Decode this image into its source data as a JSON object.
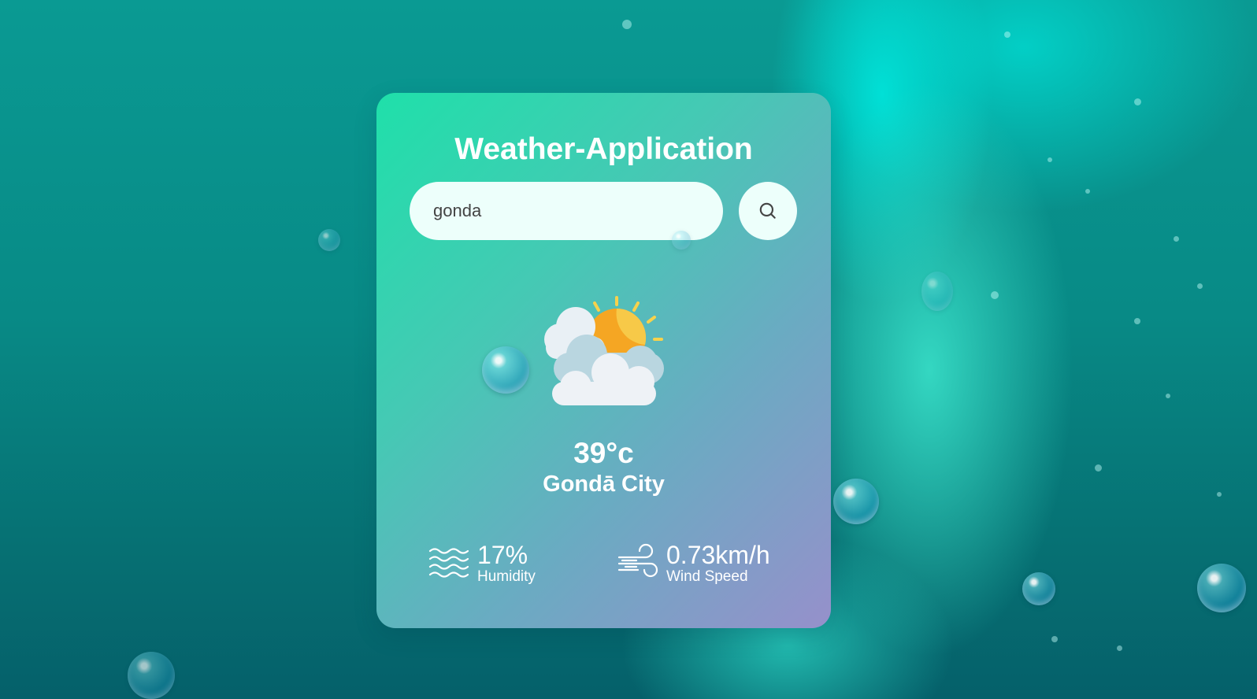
{
  "app": {
    "title": "Weather-Application"
  },
  "search": {
    "value": "gonda",
    "button_icon": "search-icon"
  },
  "weather": {
    "icon": "partly-cloudy-icon",
    "temperature": "39°c",
    "city": "Gondā City"
  },
  "stats": {
    "humidity": {
      "value": "17%",
      "label": "Humidity",
      "icon": "humidity-waves-icon"
    },
    "wind": {
      "value": "0.73km/h",
      "label": "Wind Speed",
      "icon": "wind-icon"
    }
  },
  "colors": {
    "card_gradient_start": "#1fe0aa",
    "card_gradient_end": "#9690cb",
    "input_background": "#edfffb",
    "text": "#ffffff",
    "background": "#088a86"
  }
}
